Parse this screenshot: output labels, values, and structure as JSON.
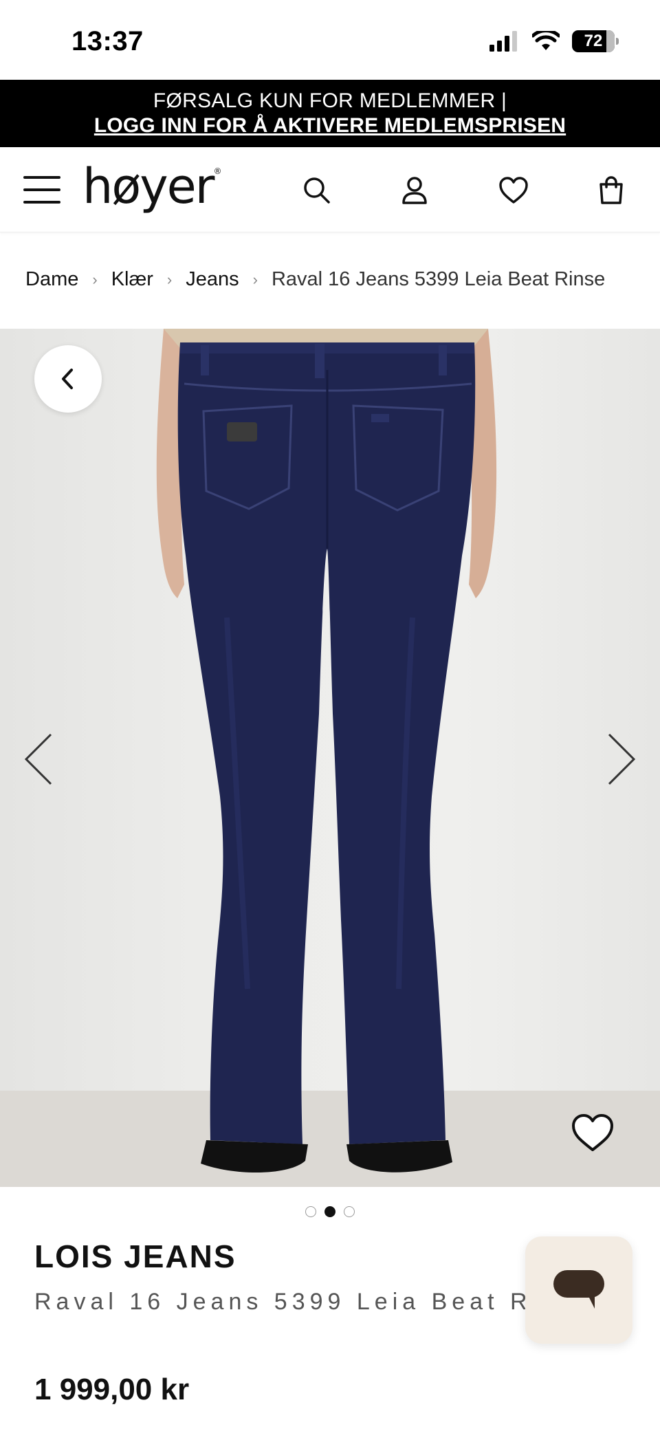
{
  "status_bar": {
    "time": "13:37",
    "battery": "72"
  },
  "promo": {
    "line1": "FØRSALG KUN FOR MEDLEMMER |",
    "line2": "LOGG INN FOR Å AKTIVERE MEDLEMSPRISEN"
  },
  "header": {
    "logo": "høyer"
  },
  "breadcrumb": {
    "items": [
      "Dame",
      "Klær",
      "Jeans"
    ],
    "separator": "›",
    "current": "Raval 16 Jeans 5399 Leia Beat Rinse"
  },
  "gallery": {
    "total_images": 3,
    "active_index": 1
  },
  "product": {
    "brand": "LOIS JEANS",
    "name": "Raval 16 Jeans 5399 Leia Beat Rinse",
    "price": "1 999,00 kr"
  },
  "colors": {
    "promo_bg": "#000000",
    "jeans": "#1f2550",
    "chat_bg": "#f3ece3",
    "chat_icon": "#3b2c22"
  },
  "icons": [
    "menu-icon",
    "search-icon",
    "user-icon",
    "heart-icon",
    "bag-icon",
    "chevron-left-icon",
    "chevron-right-icon",
    "chat-icon"
  ]
}
